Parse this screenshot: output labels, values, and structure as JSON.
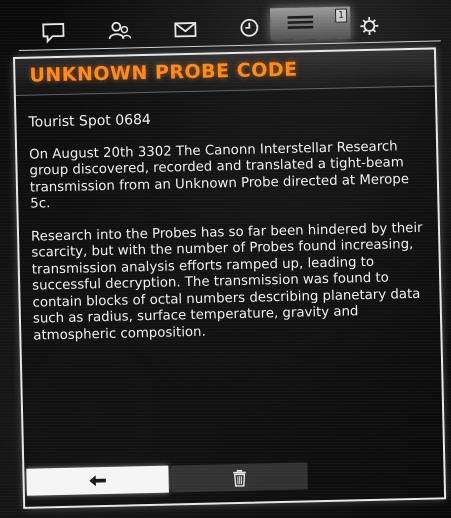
{
  "tabs": [
    {
      "icon": "chat-icon"
    },
    {
      "icon": "contacts-icon"
    },
    {
      "icon": "inbox-icon"
    },
    {
      "icon": "clock-icon"
    },
    {
      "icon": "codex-icon",
      "active": true,
      "badge": "1"
    },
    {
      "icon": "settings-icon"
    }
  ],
  "message": {
    "title": "UNKNOWN PROBE CODE",
    "subtitle": "Tourist Spot 0684",
    "paragraphs": [
      "On August 20th 3302 The Canonn Interstellar Research group discovered, recorded and translated a tight-beam transmission from an Unknown Probe directed at Merope 5c.",
      "Research into the Probes has so far been hindered by their scarcity, but with the number of Probes found increasing, transmission analysis efforts ramped up, leading to successful decryption. The transmission was found to contain blocks of octal numbers describing planetary data such as radius, surface temperature, gravity and atmospheric composition."
    ]
  },
  "actions": {
    "back_icon": "back-arrow-icon",
    "delete_icon": "trash-icon"
  },
  "colors": {
    "title": "#ff8a1c",
    "text": "#f1f1f1",
    "frame": "#e8e8e8"
  }
}
